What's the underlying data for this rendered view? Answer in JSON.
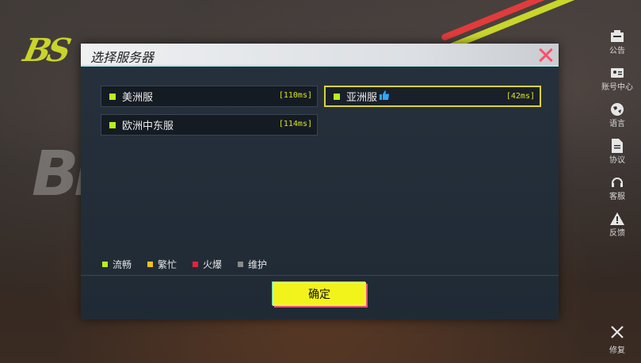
{
  "dialog": {
    "title": "选择服务器",
    "confirm_label": "确定"
  },
  "servers": [
    {
      "name": "美洲服",
      "ping": "[110ms]",
      "status_color": "#b6f21d",
      "selected": false
    },
    {
      "name": "亚洲服",
      "ping": "[42ms]",
      "status_color": "#b6f21d",
      "selected": true,
      "icon": "thumbs-up-icon"
    },
    {
      "name": "欧洲中东服",
      "ping": "[114ms]",
      "status_color": "#b6f21d",
      "selected": false
    }
  ],
  "legend": [
    {
      "label": "流畅",
      "color": "#b6f21d"
    },
    {
      "label": "繁忙",
      "color": "#f2c21a"
    },
    {
      "label": "火爆",
      "color": "#e8213a"
    },
    {
      "label": "维护",
      "color": "#8a8a8a"
    }
  ],
  "sidebar": {
    "items": [
      {
        "label": "公告",
        "icon": "notice-icon"
      },
      {
        "label": "账号中心",
        "icon": "account-icon"
      },
      {
        "label": "语言",
        "icon": "globe-icon"
      },
      {
        "label": "协议",
        "icon": "document-icon"
      },
      {
        "label": "客服",
        "icon": "headset-icon"
      },
      {
        "label": "反馈",
        "icon": "warning-icon"
      }
    ],
    "repair_label": "修复"
  },
  "logo": "BS",
  "bg_text": "BL"
}
